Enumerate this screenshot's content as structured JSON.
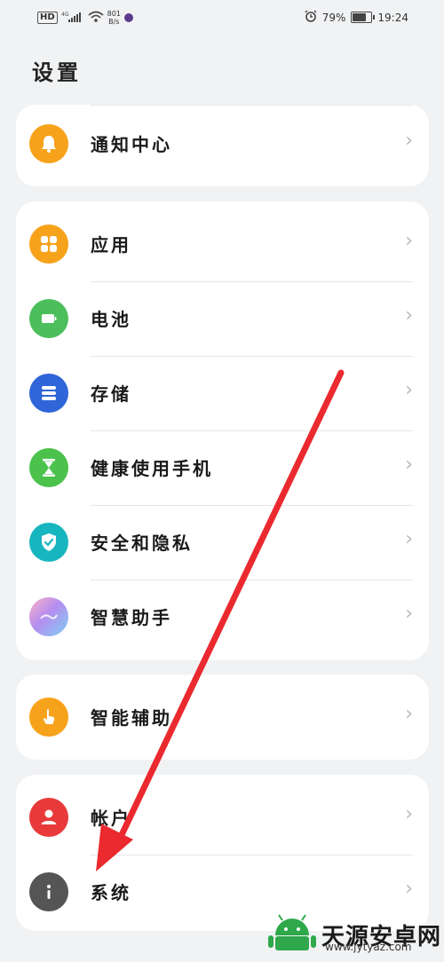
{
  "statusbar": {
    "hd": "HD",
    "net_speed_value": "801",
    "net_speed_unit": "B/s",
    "battery": "79%",
    "time": "19:24"
  },
  "page": {
    "title": "设置"
  },
  "groups": [
    {
      "items": [
        {
          "label": "通知中心",
          "icon": "bell-icon",
          "color": "#f7a21b"
        }
      ]
    },
    {
      "items": [
        {
          "label": "应用",
          "icon": "apps-icon",
          "color": "#f7a21b"
        },
        {
          "label": "电池",
          "icon": "battery-icon",
          "color": "#4cbf5c"
        },
        {
          "label": "存储",
          "icon": "storage-icon",
          "color": "#2f65d8"
        },
        {
          "label": "健康使用手机",
          "icon": "hourglass-icon",
          "color": "#4cc24d"
        },
        {
          "label": "安全和隐私",
          "icon": "shield-icon",
          "color": "#17b6bf"
        },
        {
          "label": "智慧助手",
          "icon": "assistant-icon",
          "color": "#b58df0"
        }
      ]
    },
    {
      "items": [
        {
          "label": "智能辅助",
          "icon": "hand-icon",
          "color": "#f7a21b"
        }
      ]
    },
    {
      "items": [
        {
          "label": "帐户",
          "icon": "account-icon",
          "color": "#e83a3a"
        },
        {
          "label": "系统",
          "icon": "info-icon",
          "color": "#555555"
        }
      ]
    }
  ],
  "annotation": {
    "arrow_color": "#ea2a2f"
  },
  "watermark": {
    "text": "天源安卓网",
    "url": "www.jytyaz.com"
  }
}
